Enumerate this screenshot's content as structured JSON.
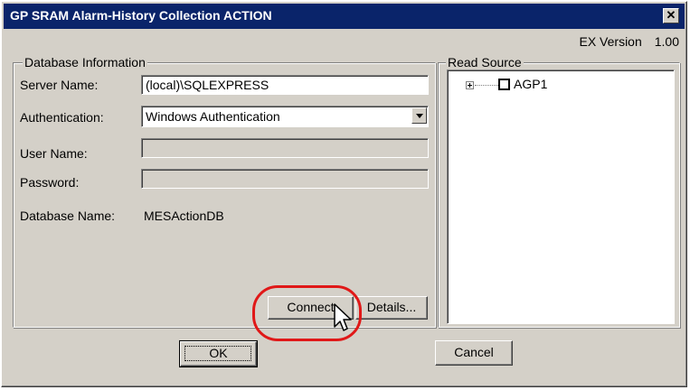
{
  "window": {
    "title": "GP SRAM Alarm-History Collection ACTION",
    "close_symbol": "✕"
  },
  "version": {
    "label": "EX Version",
    "value": "1.00"
  },
  "database_info": {
    "group_label": "Database Information",
    "server_name_label": "Server Name:",
    "server_name_value": "(local)\\SQLEXPRESS",
    "authentication_label": "Authentication:",
    "authentication_value": "Windows Authentication",
    "user_name_label": "User Name:",
    "user_name_value": "",
    "password_label": "Password:",
    "password_value": "",
    "database_name_label": "Database Name:",
    "database_name_value": "MESActionDB",
    "connect_label": "Connect",
    "details_label": "Details..."
  },
  "read_source": {
    "group_label": "Read Source",
    "items": [
      {
        "label": "AGP1",
        "checked": false,
        "expanded": false
      }
    ]
  },
  "footer": {
    "ok_label": "OK",
    "cancel_label": "Cancel"
  },
  "colors": {
    "titlebar": "#0a246a",
    "dialog_face": "#d4d0c8",
    "highlight_ring": "#e01818"
  }
}
